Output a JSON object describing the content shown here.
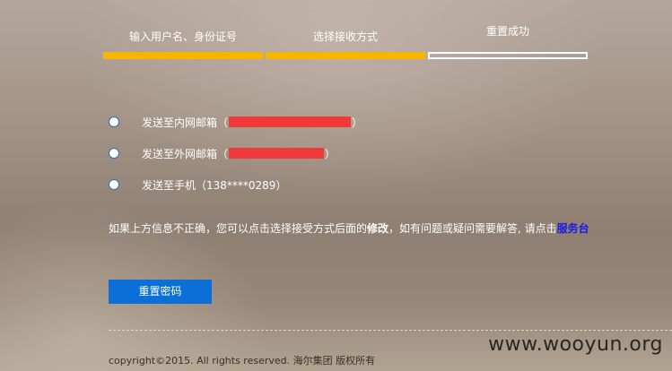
{
  "stepper": {
    "steps": [
      {
        "label": "输入用户名、身份证号",
        "state": "completed"
      },
      {
        "label": "选择接收方式",
        "state": "completed"
      },
      {
        "label": "重置成功",
        "state": "pending"
      }
    ],
    "active_color": "#f7b500"
  },
  "options": [
    {
      "label": "发送至内网邮箱（",
      "suffix": "）",
      "selected": false
    },
    {
      "label": "发送至外网邮箱（",
      "suffix": "）",
      "selected": false
    },
    {
      "label": "发送至手机（138****0289）",
      "selected": false
    }
  ],
  "info": {
    "text_before": "如果上方信息不正确，您可以点击选择接受方式后面的",
    "bold_word": "修改",
    "text_after": "，如有问题或疑问需要解答, 请点击",
    "link_text": "服务台"
  },
  "reset_button": {
    "label": "重置密码",
    "color": "#0a6fd6"
  },
  "footer": {
    "copyright": "copyright©2015. All rights reserved. 海尔集团 版权所有"
  },
  "watermark": {
    "text": "www.wooyun.org"
  }
}
